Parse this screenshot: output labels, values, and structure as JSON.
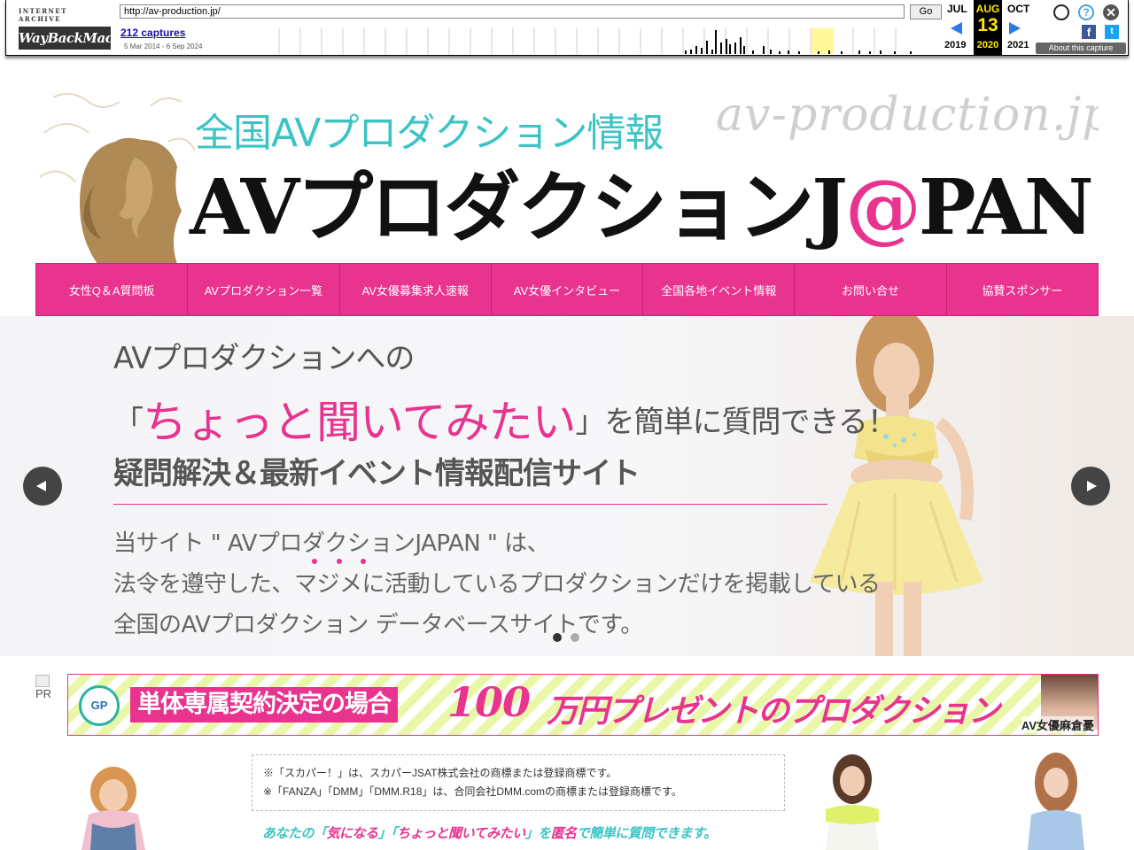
{
  "wayback": {
    "logo_top": "INTERNET ARCHIVE",
    "logo_main": "WayBackMachine",
    "url": "http://av-production.jp/",
    "go": "Go",
    "captures": "212 captures",
    "range": "5 Mar 2014 - 6 Sep 2024",
    "months": {
      "prev": "JUL",
      "cur": "AUG",
      "next": "OCT"
    },
    "day": "13",
    "years": {
      "prev": "2019",
      "cur": "2020",
      "next": "2021"
    },
    "about": "About this capture",
    "help_glyph": "?",
    "close_glyph": "✕",
    "fb_glyph": "f",
    "tw_glyph": "t",
    "icons": [
      "user-icon",
      "help-icon",
      "close-icon",
      "facebook-icon",
      "twitter-icon"
    ]
  },
  "header": {
    "subtitle": "全国AVプロダクション情報",
    "domain": "av-production.jp",
    "title_pre": "AVプロダクションJ",
    "title_at": "@",
    "title_post": "PAN"
  },
  "nav": [
    "女性Q＆A質問板",
    "AVプロダクション一覧",
    "AV女優募集求人速報",
    "AV女優インタビュー",
    "全国各地イベント情報",
    "お問い合せ",
    "協賛スポンサー"
  ],
  "hero": {
    "line1": "AVプロダクションへの",
    "line2_open": "「",
    "line2_big": "ちょっと聞いてみたい",
    "line2_rest": "」を簡単に質問できる！",
    "line3": "疑問解決＆最新イベント情報配信サイト",
    "para1": "当サイト \" AVプロダクションJAPAN \" は、",
    "para2": "法令を遵守した、マジメに活動しているプロダクションだけを掲載している",
    "para3": "全国のAVプロダクション データベースサイトです。"
  },
  "pr": {
    "alt": "PR",
    "logo": "GP",
    "text1": "単体専属契約決定の場合",
    "big": "100",
    "text2": "万円プレゼントのプロダクション",
    "caption": "AV女優麻倉憂"
  },
  "notice": {
    "line1": "※「スカパー！」は、スカパーJSAT株式会社の商標または登録商標です。",
    "line2": "※「FANZA」「DMM」「DMM.R18」は、合同会社DMM.comの商標または登録商標です。"
  },
  "tagline": {
    "a": "あなたの「",
    "b": "気になる",
    "c": "」「",
    "d": "ちょっと聞いてみたい",
    "e": "」を",
    "f": "匿名",
    "g": "で簡単に質問できます。"
  },
  "colors": {
    "accent_pink": "#e8338f",
    "teal": "#3cc3c5",
    "wayback_yellow": "#ffe800"
  }
}
